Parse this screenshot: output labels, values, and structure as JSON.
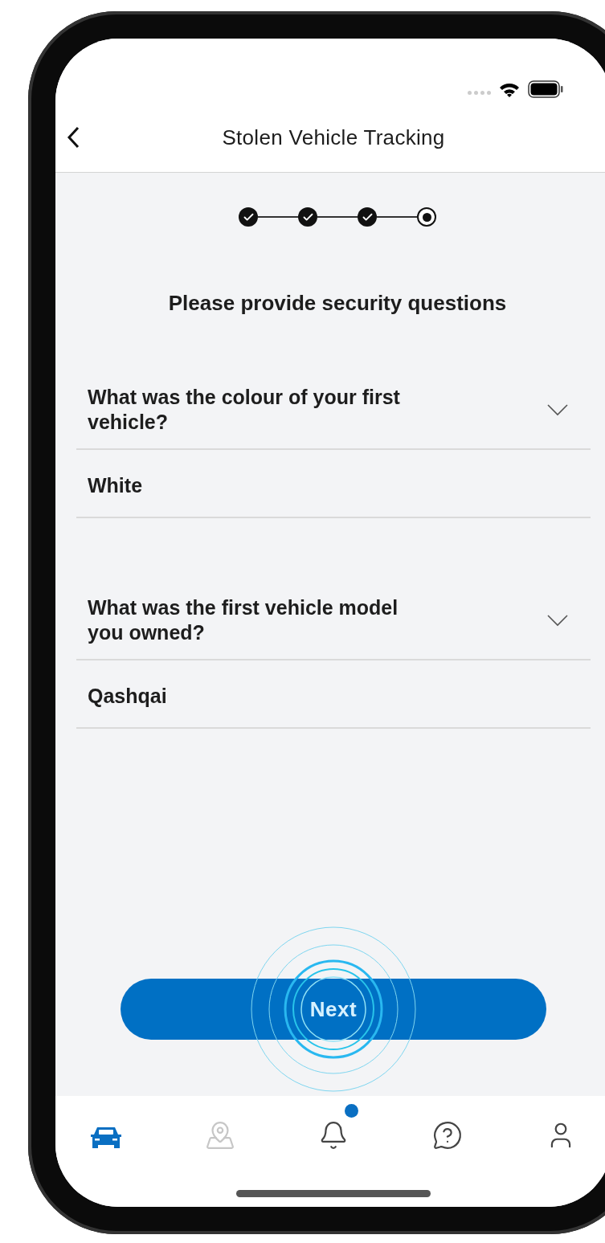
{
  "header": {
    "title": "Stolen Vehicle Tracking"
  },
  "steps": [
    {
      "completed": true
    },
    {
      "completed": true
    },
    {
      "completed": true
    },
    {
      "completed": false
    }
  ],
  "heading": "Please provide security questions",
  "questions": [
    {
      "question": "What was the colour of your first vehicle?",
      "answer": "White"
    },
    {
      "question": "What was the first vehicle model you owned?",
      "answer": "Qashqai"
    }
  ],
  "next_button": {
    "label": "Next"
  },
  "tab_bar": [
    {
      "kind": "car",
      "selected": true,
      "disabled": false,
      "badge": false
    },
    {
      "kind": "map",
      "selected": false,
      "disabled": true,
      "badge": false
    },
    {
      "kind": "bell",
      "selected": false,
      "disabled": false,
      "badge": true
    },
    {
      "kind": "help",
      "selected": false,
      "disabled": false,
      "badge": false
    },
    {
      "kind": "profile",
      "selected": false,
      "disabled": false,
      "badge": false
    }
  ]
}
